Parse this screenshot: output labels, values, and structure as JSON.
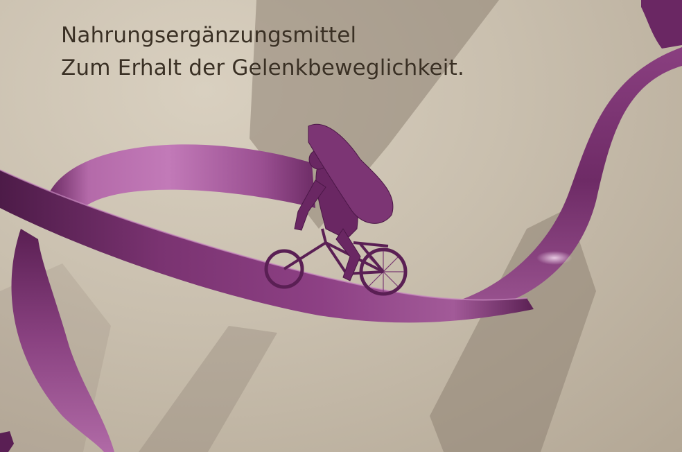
{
  "caption": {
    "line1": "Nahrungsergänzungsmittel",
    "line2": "Zum Erhalt der Gelenkbeweglichkeit."
  },
  "colors": {
    "wall": "#c9bfae",
    "ribbon_light": "#b86fb0",
    "ribbon_dark": "#4a1a45",
    "shadow": "#7a6f63",
    "text": "#3a3024"
  },
  "icons": [
    "cyclist-figurine",
    "ribbon-sculpture"
  ]
}
